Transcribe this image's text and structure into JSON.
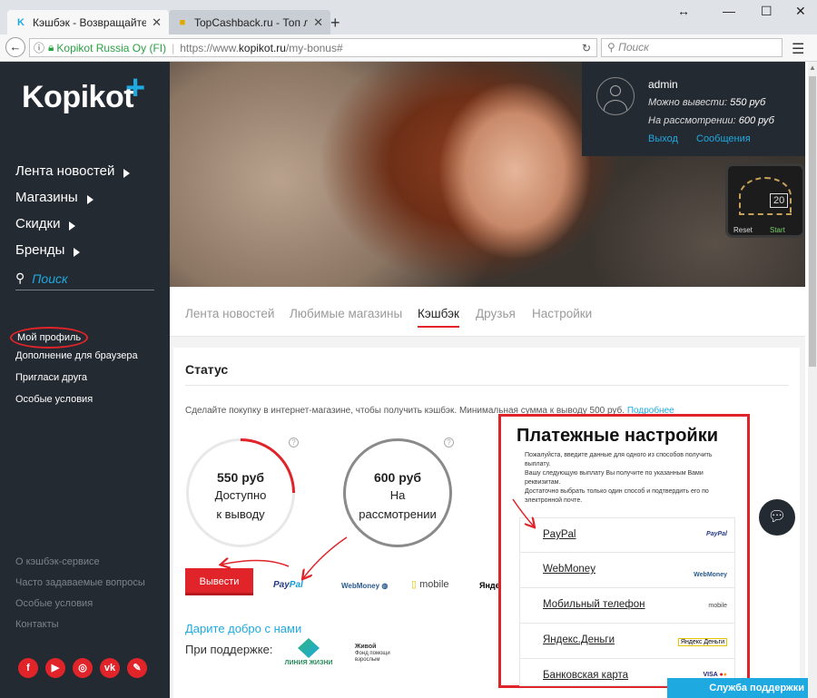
{
  "browser": {
    "tabs": [
      {
        "label": "Кэшбэк - Возвращайте д"
      },
      {
        "label": "TopCashback.ru - Топ лу"
      }
    ],
    "address": {
      "identity": "Kopikot Russia Oy (FI)",
      "url_prefix": "https://www.",
      "url_domain": "kopikot.ru",
      "url_path": "/my-bonus#"
    },
    "search_placeholder": "Поиск"
  },
  "sidebar": {
    "logo": "Kopikot",
    "main_nav": [
      {
        "label": "Лента новостей"
      },
      {
        "label": "Магазины"
      },
      {
        "label": "Скидки"
      },
      {
        "label": "Бренды"
      }
    ],
    "search_label": "Поиск",
    "sub_nav": [
      {
        "label": "Мой профиль"
      },
      {
        "label": "Дополнение для браузера"
      },
      {
        "label": "Пригласи друга"
      },
      {
        "label": "Особые условия"
      }
    ],
    "footer_nav": [
      {
        "label": "О кэшбэк-сервисе"
      },
      {
        "label": "Часто задаваемые вопросы"
      },
      {
        "label": "Особые условия"
      },
      {
        "label": "Контакты"
      }
    ]
  },
  "user": {
    "name": "admin",
    "withdrawable_label": "Можно вывести:",
    "withdrawable_value": "550 руб",
    "pending_label": "На рассмотрении:",
    "pending_value": "600 руб",
    "logout": "Выход",
    "messages": "Сообщения"
  },
  "tabs": [
    {
      "label": "Лента новостей"
    },
    {
      "label": "Любимые магазины"
    },
    {
      "label": "Кэшбэк"
    },
    {
      "label": "Друзья"
    },
    {
      "label": "Настройки"
    }
  ],
  "status": {
    "title": "Статус",
    "description": "Сделайте покупку в интернет-магазине, чтобы получить кэшбэк. Минимальная сумма к выводу 500 руб.",
    "more_link": "Подробнее",
    "available": {
      "amount": "550 руб",
      "line1": "Доступно",
      "line2": "к выводу"
    },
    "pending": {
      "amount": "600 руб",
      "line1": "На",
      "line2": "рассмотрении"
    },
    "withdraw_button": "Вывести",
    "payment_logos": {
      "paypal_a": "Pay",
      "paypal_b": "Pal",
      "webmoney": "WebMoney",
      "mobile": "mobile",
      "yandex": "Яндекс"
    },
    "charity_link": "Дарите добро с нами",
    "support_label": "При поддержке:",
    "partner1": "ЛИНИЯ ЖИЗНИ",
    "partner2_a": "Живой",
    "partner2_b": "Фонд помощи взрослым"
  },
  "payment_settings": {
    "title": "Платежные настройки",
    "text1": "Пожалуйста, введите данные для одного из способов получить выплату.",
    "text2": "Вашу следующую выплату Вы получите по указанным Вами реквизитам.",
    "text3": "Достаточно выбрать только один способ и подтвердить его по электронной почте.",
    "methods": [
      {
        "label": "PayPal",
        "logo": "PayPal"
      },
      {
        "label": "WebMoney",
        "logo": "WebMoney"
      },
      {
        "label": "Мобильный телефон",
        "logo": "mobile"
      },
      {
        "label": "Яндекс.Деньги",
        "logo": "Яндекс Деньги"
      },
      {
        "label": "Банковская карта",
        "logo": "VISA"
      }
    ]
  },
  "support_button": "Служба поддержки",
  "colors": {
    "accent_red": "#e0242a",
    "accent_blue": "#1fa9e1",
    "sidebar_bg": "#242a31"
  }
}
